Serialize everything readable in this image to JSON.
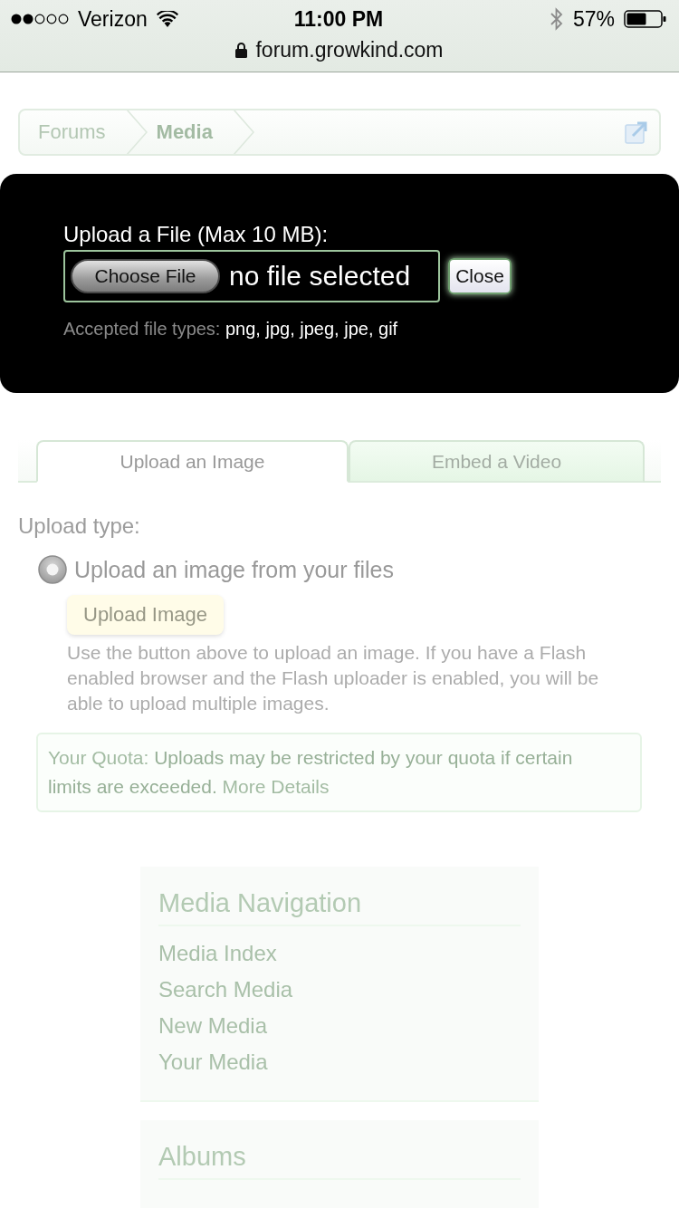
{
  "status_bar": {
    "carrier": "Verizon",
    "time": "11:00 PM",
    "battery": "57%"
  },
  "address_bar": {
    "url": "forum.growkind.com"
  },
  "breadcrumb": [
    {
      "label": "Forums",
      "current": false
    },
    {
      "label": "Media",
      "current": true
    }
  ],
  "upload_dialog": {
    "title": "Upload a File (Max 10 MB):",
    "choose_button": "Choose File",
    "file_status": "no file selected",
    "close_button": "Close",
    "accepted_label": "Accepted file types:",
    "accepted_types": "png, jpg, jpeg, jpe, gif"
  },
  "tabs": [
    {
      "label": "Upload an Image",
      "selected": true
    },
    {
      "label": "Embed a Video",
      "selected": false
    }
  ],
  "upload_type": {
    "label": "Upload type:",
    "options": [
      {
        "label": "Upload an image from your files",
        "selected": true
      }
    ],
    "button": "Upload Image",
    "help": "Use the button above to upload an image. If you have a Flash enabled browser and the Flash uploader is enabled, you will be able to upload multiple images."
  },
  "quota": {
    "label": "Your Quota:",
    "text": "Uploads may be restricted by your quota if certain limits are exceeded.",
    "link": "More Details"
  },
  "sidebar_blocks": [
    {
      "title": "Media Navigation",
      "items": [
        "Media Index",
        "Search Media",
        "New Media",
        "Your Media"
      ]
    },
    {
      "title": "Albums"
    }
  ]
}
